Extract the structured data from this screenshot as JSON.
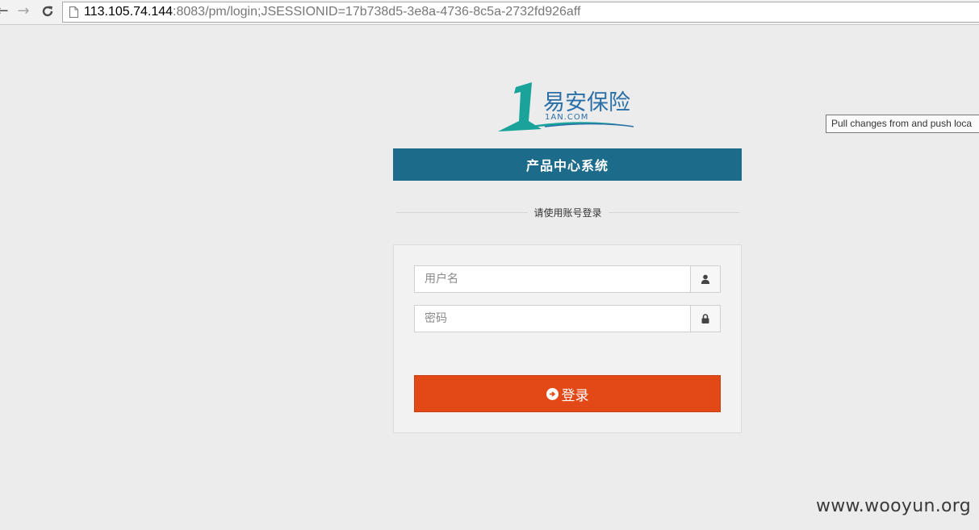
{
  "browser": {
    "url_host": "113.105.74.144",
    "url_rest": ":8083/pm/login;JSESSIONID=17b738d5-3e8a-4736-8c5a-2732fd926aff",
    "back_icon": "arrow-left-icon",
    "forward_icon": "arrow-right-icon",
    "reload_icon": "reload-icon"
  },
  "logo": {
    "brand_name": "易安保险",
    "brand_domain": "1AN.COM",
    "colors": {
      "teal": "#1aa39a",
      "blue": "#2a6fa8"
    }
  },
  "header": {
    "title": "产品中心系统",
    "color": "#1d6b8a"
  },
  "login": {
    "divider_text": "请使用账号登录",
    "username_placeholder": "用户名",
    "password_placeholder": "密码",
    "submit_label": "登录",
    "submit_color": "#e34817"
  },
  "tooltip": {
    "text": "Pull changes from and push loca"
  },
  "watermark": {
    "text": "www.wooyun.org"
  }
}
